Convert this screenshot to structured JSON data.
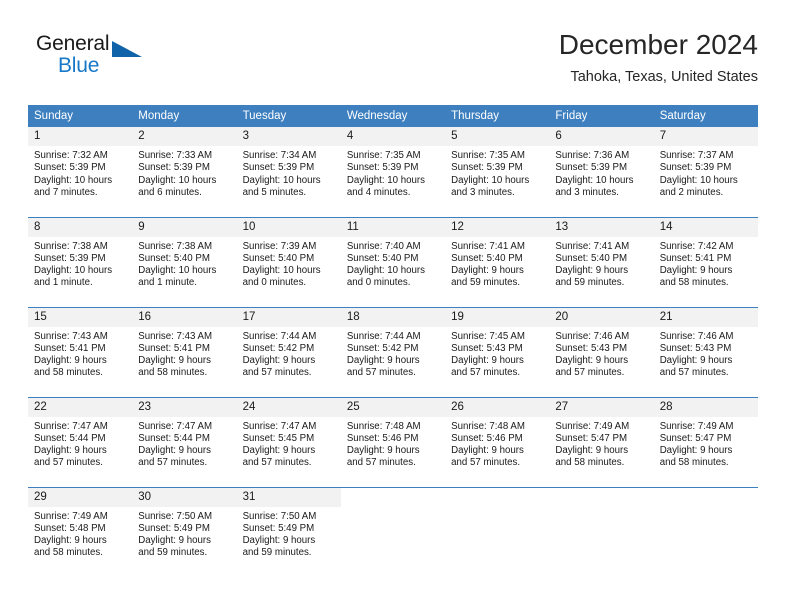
{
  "brand": {
    "name_part1": "General",
    "name_part2": "Blue",
    "accent_color": "#1878c8",
    "triangle_color": "#1063a8"
  },
  "header": {
    "month_title": "December 2024",
    "location": "Tahoka, Texas, United States"
  },
  "calendar": {
    "header_bg": "#3d7fbf",
    "daynum_bg": "#f2f2f2",
    "weekdays": [
      "Sunday",
      "Monday",
      "Tuesday",
      "Wednesday",
      "Thursday",
      "Friday",
      "Saturday"
    ],
    "weeks": [
      [
        {
          "day": "1",
          "sunrise": "Sunrise: 7:32 AM",
          "sunset": "Sunset: 5:39 PM",
          "daylight1": "Daylight: 10 hours",
          "daylight2": "and 7 minutes."
        },
        {
          "day": "2",
          "sunrise": "Sunrise: 7:33 AM",
          "sunset": "Sunset: 5:39 PM",
          "daylight1": "Daylight: 10 hours",
          "daylight2": "and 6 minutes."
        },
        {
          "day": "3",
          "sunrise": "Sunrise: 7:34 AM",
          "sunset": "Sunset: 5:39 PM",
          "daylight1": "Daylight: 10 hours",
          "daylight2": "and 5 minutes."
        },
        {
          "day": "4",
          "sunrise": "Sunrise: 7:35 AM",
          "sunset": "Sunset: 5:39 PM",
          "daylight1": "Daylight: 10 hours",
          "daylight2": "and 4 minutes."
        },
        {
          "day": "5",
          "sunrise": "Sunrise: 7:35 AM",
          "sunset": "Sunset: 5:39 PM",
          "daylight1": "Daylight: 10 hours",
          "daylight2": "and 3 minutes."
        },
        {
          "day": "6",
          "sunrise": "Sunrise: 7:36 AM",
          "sunset": "Sunset: 5:39 PM",
          "daylight1": "Daylight: 10 hours",
          "daylight2": "and 3 minutes."
        },
        {
          "day": "7",
          "sunrise": "Sunrise: 7:37 AM",
          "sunset": "Sunset: 5:39 PM",
          "daylight1": "Daylight: 10 hours",
          "daylight2": "and 2 minutes."
        }
      ],
      [
        {
          "day": "8",
          "sunrise": "Sunrise: 7:38 AM",
          "sunset": "Sunset: 5:39 PM",
          "daylight1": "Daylight: 10 hours",
          "daylight2": "and 1 minute."
        },
        {
          "day": "9",
          "sunrise": "Sunrise: 7:38 AM",
          "sunset": "Sunset: 5:40 PM",
          "daylight1": "Daylight: 10 hours",
          "daylight2": "and 1 minute."
        },
        {
          "day": "10",
          "sunrise": "Sunrise: 7:39 AM",
          "sunset": "Sunset: 5:40 PM",
          "daylight1": "Daylight: 10 hours",
          "daylight2": "and 0 minutes."
        },
        {
          "day": "11",
          "sunrise": "Sunrise: 7:40 AM",
          "sunset": "Sunset: 5:40 PM",
          "daylight1": "Daylight: 10 hours",
          "daylight2": "and 0 minutes."
        },
        {
          "day": "12",
          "sunrise": "Sunrise: 7:41 AM",
          "sunset": "Sunset: 5:40 PM",
          "daylight1": "Daylight: 9 hours",
          "daylight2": "and 59 minutes."
        },
        {
          "day": "13",
          "sunrise": "Sunrise: 7:41 AM",
          "sunset": "Sunset: 5:40 PM",
          "daylight1": "Daylight: 9 hours",
          "daylight2": "and 59 minutes."
        },
        {
          "day": "14",
          "sunrise": "Sunrise: 7:42 AM",
          "sunset": "Sunset: 5:41 PM",
          "daylight1": "Daylight: 9 hours",
          "daylight2": "and 58 minutes."
        }
      ],
      [
        {
          "day": "15",
          "sunrise": "Sunrise: 7:43 AM",
          "sunset": "Sunset: 5:41 PM",
          "daylight1": "Daylight: 9 hours",
          "daylight2": "and 58 minutes."
        },
        {
          "day": "16",
          "sunrise": "Sunrise: 7:43 AM",
          "sunset": "Sunset: 5:41 PM",
          "daylight1": "Daylight: 9 hours",
          "daylight2": "and 58 minutes."
        },
        {
          "day": "17",
          "sunrise": "Sunrise: 7:44 AM",
          "sunset": "Sunset: 5:42 PM",
          "daylight1": "Daylight: 9 hours",
          "daylight2": "and 57 minutes."
        },
        {
          "day": "18",
          "sunrise": "Sunrise: 7:44 AM",
          "sunset": "Sunset: 5:42 PM",
          "daylight1": "Daylight: 9 hours",
          "daylight2": "and 57 minutes."
        },
        {
          "day": "19",
          "sunrise": "Sunrise: 7:45 AM",
          "sunset": "Sunset: 5:43 PM",
          "daylight1": "Daylight: 9 hours",
          "daylight2": "and 57 minutes."
        },
        {
          "day": "20",
          "sunrise": "Sunrise: 7:46 AM",
          "sunset": "Sunset: 5:43 PM",
          "daylight1": "Daylight: 9 hours",
          "daylight2": "and 57 minutes."
        },
        {
          "day": "21",
          "sunrise": "Sunrise: 7:46 AM",
          "sunset": "Sunset: 5:43 PM",
          "daylight1": "Daylight: 9 hours",
          "daylight2": "and 57 minutes."
        }
      ],
      [
        {
          "day": "22",
          "sunrise": "Sunrise: 7:47 AM",
          "sunset": "Sunset: 5:44 PM",
          "daylight1": "Daylight: 9 hours",
          "daylight2": "and 57 minutes."
        },
        {
          "day": "23",
          "sunrise": "Sunrise: 7:47 AM",
          "sunset": "Sunset: 5:44 PM",
          "daylight1": "Daylight: 9 hours",
          "daylight2": "and 57 minutes."
        },
        {
          "day": "24",
          "sunrise": "Sunrise: 7:47 AM",
          "sunset": "Sunset: 5:45 PM",
          "daylight1": "Daylight: 9 hours",
          "daylight2": "and 57 minutes."
        },
        {
          "day": "25",
          "sunrise": "Sunrise: 7:48 AM",
          "sunset": "Sunset: 5:46 PM",
          "daylight1": "Daylight: 9 hours",
          "daylight2": "and 57 minutes."
        },
        {
          "day": "26",
          "sunrise": "Sunrise: 7:48 AM",
          "sunset": "Sunset: 5:46 PM",
          "daylight1": "Daylight: 9 hours",
          "daylight2": "and 57 minutes."
        },
        {
          "day": "27",
          "sunrise": "Sunrise: 7:49 AM",
          "sunset": "Sunset: 5:47 PM",
          "daylight1": "Daylight: 9 hours",
          "daylight2": "and 58 minutes."
        },
        {
          "day": "28",
          "sunrise": "Sunrise: 7:49 AM",
          "sunset": "Sunset: 5:47 PM",
          "daylight1": "Daylight: 9 hours",
          "daylight2": "and 58 minutes."
        }
      ],
      [
        {
          "day": "29",
          "sunrise": "Sunrise: 7:49 AM",
          "sunset": "Sunset: 5:48 PM",
          "daylight1": "Daylight: 9 hours",
          "daylight2": "and 58 minutes."
        },
        {
          "day": "30",
          "sunrise": "Sunrise: 7:50 AM",
          "sunset": "Sunset: 5:49 PM",
          "daylight1": "Daylight: 9 hours",
          "daylight2": "and 59 minutes."
        },
        {
          "day": "31",
          "sunrise": "Sunrise: 7:50 AM",
          "sunset": "Sunset: 5:49 PM",
          "daylight1": "Daylight: 9 hours",
          "daylight2": "and 59 minutes."
        },
        {
          "day": "",
          "sunrise": "",
          "sunset": "",
          "daylight1": "",
          "daylight2": ""
        },
        {
          "day": "",
          "sunrise": "",
          "sunset": "",
          "daylight1": "",
          "daylight2": ""
        },
        {
          "day": "",
          "sunrise": "",
          "sunset": "",
          "daylight1": "",
          "daylight2": ""
        },
        {
          "day": "",
          "sunrise": "",
          "sunset": "",
          "daylight1": "",
          "daylight2": ""
        }
      ]
    ]
  }
}
